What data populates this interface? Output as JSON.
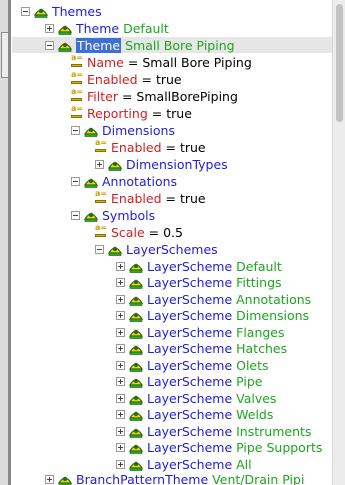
{
  "tree": {
    "themes_label": "Themes",
    "theme_default": {
      "type": "Theme",
      "name": "Default"
    },
    "theme_sbp": {
      "type": "Theme",
      "name": "Small Bore Piping"
    },
    "props": {
      "name": {
        "key": "Name",
        "value": "Small Bore Piping"
      },
      "enabled": {
        "key": "Enabled",
        "value": "true"
      },
      "filter": {
        "key": "Filter",
        "value": "SmallBorePiping"
      },
      "reporting": {
        "key": "Reporting",
        "value": "true"
      }
    },
    "dimensions": {
      "label": "Dimensions",
      "enabled_key": "Enabled",
      "enabled_value": "true",
      "types_label": "DimensionTypes"
    },
    "annotations": {
      "label": "Annotations",
      "enabled_key": "Enabled",
      "enabled_value": "true"
    },
    "symbols": {
      "label": "Symbols",
      "scale_key": "Scale",
      "scale_value": "0.5",
      "layerschemes_label": "LayerSchemes"
    },
    "layer_scheme_type": "LayerScheme",
    "layer_schemes": [
      "Default",
      "Fittings",
      "Annotations",
      "Dimensions",
      "Flanges",
      "Hatches",
      "Olets",
      "Pipe",
      "Valves",
      "Welds",
      "Instruments",
      "Pipe Supports",
      "All"
    ],
    "branch": {
      "type": "BranchPatternTheme",
      "name": "Vent/Drain Pipi"
    },
    "eq_sign": "="
  }
}
